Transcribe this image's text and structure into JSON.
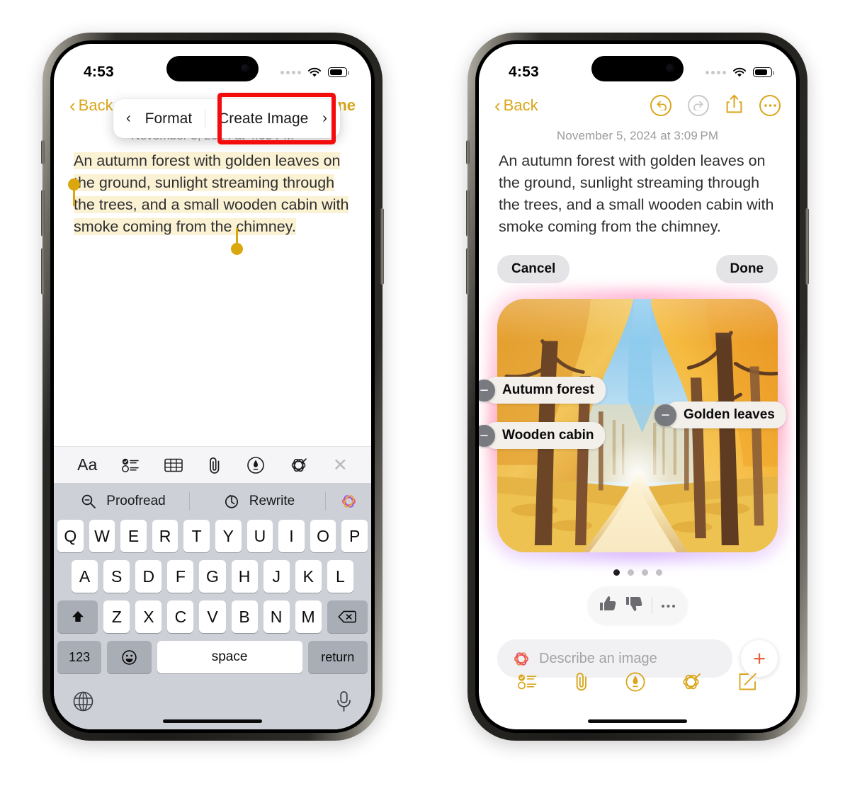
{
  "left_phone": {
    "status": {
      "time": "4:53",
      "signal_icon": "cellular-dots-icon",
      "wifi_icon": "wifi-icon",
      "battery_icon": "battery-icon"
    },
    "nav": {
      "back_label": "Back",
      "done_label": "Done"
    },
    "popover": {
      "prev_arrow": "‹",
      "format_label": "Format",
      "create_image_label": "Create Image",
      "next_arrow": "›",
      "highlight_color": "#f40c0c"
    },
    "note": {
      "date": "November 5, 2024 at 4:03 PM",
      "selected_text": "An autumn forest with golden leaves on the ground, sunlight streaming through the trees, and a small wooden cabin with smoke coming from the chimney.",
      "selection_color": "#dba70f",
      "highlight_color": "#fbf2d4"
    },
    "keyboard_toolbar": [
      {
        "name": "text-format-icon",
        "label": "Aa"
      },
      {
        "name": "checklist-icon",
        "label": ""
      },
      {
        "name": "table-icon",
        "label": ""
      },
      {
        "name": "attachment-icon",
        "label": ""
      },
      {
        "name": "markup-pen-icon",
        "label": ""
      },
      {
        "name": "apple-intelligence-icon",
        "label": ""
      },
      {
        "name": "close-icon",
        "label": ""
      }
    ],
    "writing_tools": {
      "proofread_label": "Proofread",
      "rewrite_label": "Rewrite",
      "sparkle_icon": "apple-intelligence-icon"
    },
    "keyboard": {
      "row1": [
        "Q",
        "W",
        "E",
        "R",
        "T",
        "Y",
        "U",
        "I",
        "O",
        "P"
      ],
      "row2": [
        "A",
        "S",
        "D",
        "F",
        "G",
        "H",
        "J",
        "K",
        "L"
      ],
      "row3": [
        "Z",
        "X",
        "C",
        "V",
        "B",
        "N",
        "M"
      ],
      "shift_icon": "shift-icon",
      "backspace_icon": "backspace-icon",
      "numbers_label": "123",
      "emoji_icon": "emoji-icon",
      "space_label": "space",
      "return_label": "return",
      "globe_icon": "globe-icon",
      "mic_icon": "microphone-icon"
    }
  },
  "right_phone": {
    "status": {
      "time": "4:53",
      "signal_icon": "cellular-dots-icon",
      "wifi_icon": "wifi-icon",
      "battery_icon": "battery-icon"
    },
    "nav": {
      "back_label": "Back",
      "undo_icon": "undo-icon",
      "redo_icon": "redo-icon",
      "share_icon": "share-icon",
      "more_icon": "more-ellipsis-icon",
      "accent_color": "#d9a61b",
      "disabled_color": "#c9c9cc"
    },
    "note": {
      "date": "November 5, 2024 at 3:09 PM",
      "text": "An autumn forest with golden leaves on the ground, sunlight streaming through the trees, and a small wooden cabin with smoke coming from the chimney."
    },
    "playground": {
      "cancel_label": "Cancel",
      "done_label": "Done",
      "tags": [
        {
          "label": "Autumn forest",
          "remove_icon": "minus-circle-icon"
        },
        {
          "label": "Wooden cabin",
          "remove_icon": "minus-circle-icon"
        },
        {
          "label": "Golden leaves",
          "remove_icon": "minus-circle-icon"
        }
      ],
      "page_dots": {
        "total": 4,
        "active_index": 0
      },
      "feedback": {
        "thumbs_up_icon": "thumbs-up-icon",
        "thumbs_down_icon": "thumbs-down-icon",
        "more_icon": "more-ellipsis-icon"
      },
      "prompt": {
        "placeholder": "Describe an image",
        "value": "",
        "leading_icon": "apple-intelligence-icon",
        "add_icon": "plus-icon",
        "add_color": "#e4613b"
      },
      "image_alt": "Autumn forest path with golden leaves and sunlight"
    },
    "bottom_toolbar": [
      {
        "name": "checklist-icon"
      },
      {
        "name": "attachment-icon"
      },
      {
        "name": "markup-pen-icon"
      },
      {
        "name": "apple-intelligence-icon"
      },
      {
        "name": "compose-icon"
      }
    ]
  }
}
